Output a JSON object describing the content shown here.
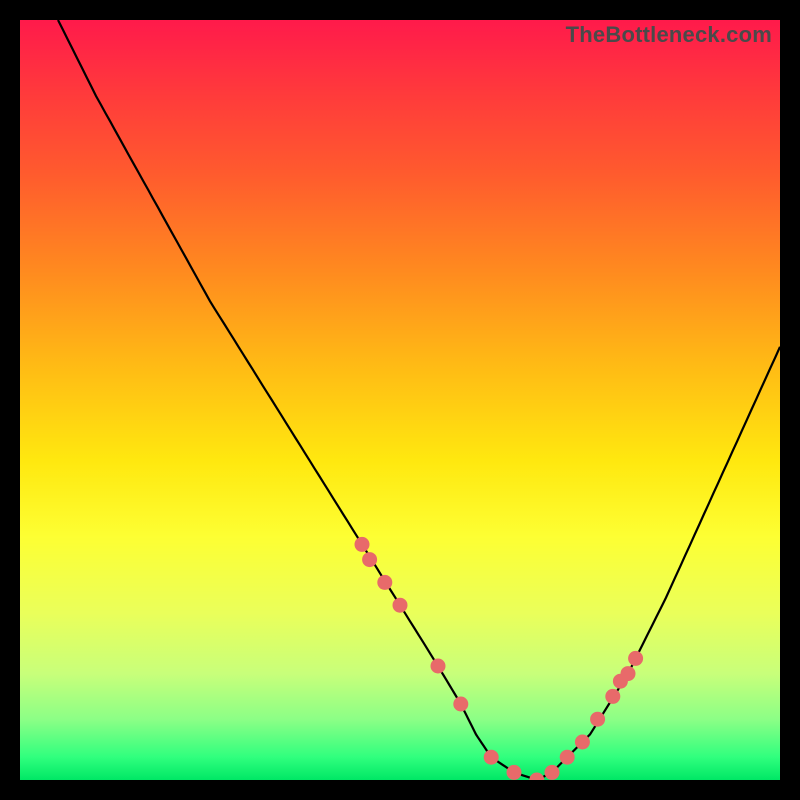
{
  "watermark": "TheBottleneck.com",
  "colors": {
    "dot": "#e86a6a",
    "curve": "#000000"
  },
  "chart_data": {
    "type": "line",
    "title": "",
    "xlabel": "",
    "ylabel": "",
    "xlim": [
      0,
      100
    ],
    "ylim": [
      0,
      100
    ],
    "x": [
      5,
      10,
      15,
      20,
      25,
      30,
      35,
      40,
      45,
      50,
      55,
      58,
      60,
      62,
      65,
      68,
      70,
      75,
      80,
      85,
      90,
      95,
      100
    ],
    "values": [
      100,
      90,
      81,
      72,
      63,
      55,
      47,
      39,
      31,
      23,
      15,
      10,
      6,
      3,
      1,
      0,
      1,
      6,
      14,
      24,
      35,
      46,
      57
    ],
    "markers_x": [
      45,
      46,
      48,
      50,
      55,
      58,
      62,
      65,
      68,
      70,
      72,
      74,
      76,
      78,
      79,
      80,
      81
    ],
    "markers_y": [
      31,
      29,
      26,
      23,
      15,
      10,
      3,
      1,
      0,
      1,
      3,
      5,
      8,
      11,
      13,
      14,
      16
    ]
  }
}
